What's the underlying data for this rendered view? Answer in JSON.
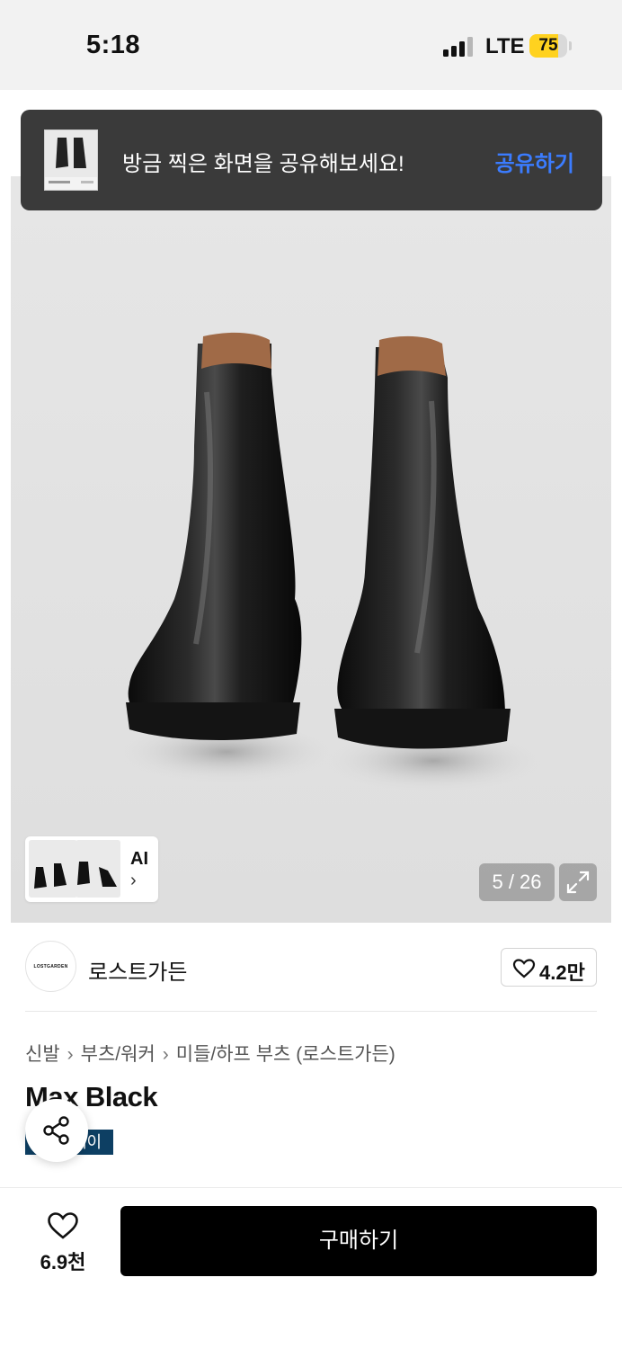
{
  "status_bar": {
    "time": "5:18",
    "network": "LTE",
    "battery": "75",
    "battery_level": 0.75
  },
  "toast": {
    "message": "방금 찍은 화면을 공유해보세요!",
    "action": "공유하기"
  },
  "gallery": {
    "ai_label": "AI",
    "chevron": "›",
    "counter": "5 / 26",
    "icons": [
      "expand-icon",
      "chevron-right-icon"
    ]
  },
  "brand": {
    "name": "로스트가든",
    "logo_text": "LOSTGARDEN",
    "likes": "4.2만"
  },
  "breadcrumb": {
    "items": [
      "신발",
      "부츠/워커",
      "미들/하프 부츠 (로스트가든)"
    ],
    "separator": "›"
  },
  "product": {
    "title": "Max Black",
    "tag": "페이"
  },
  "bottom_bar": {
    "wish_count": "6.9천",
    "buy_label": "구매하기"
  },
  "colors": {
    "accent_blue": "#3b7cff",
    "toast_bg": "#3a3a3a",
    "battery_yellow": "#ffd21f",
    "tag_navy": "#0d3f63",
    "buy_black": "#000000"
  }
}
